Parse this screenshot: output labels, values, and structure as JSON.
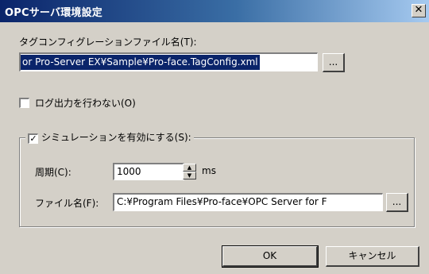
{
  "window": {
    "title": "OPCサーバ環境設定",
    "close_glyph": "✕"
  },
  "tag_config": {
    "label": "タグコンフィグレーションファイル名(T):",
    "path_value": "or Pro-Server EX¥Sample¥Pro-face.TagConfig.xml",
    "browse_label": "..."
  },
  "no_log": {
    "checked": false,
    "label": "ログ出力を行わない(O)"
  },
  "simulation": {
    "checked": true,
    "check_glyph": "✓",
    "label": "シミュレーションを有効にする(S):",
    "period_label": "周期(C):",
    "period_value": "1000",
    "period_unit": "ms",
    "file_label": "ファイル名(F):",
    "file_value": "C:¥Program Files¥Pro-face¥OPC Server for F",
    "browse_label": "..."
  },
  "buttons": {
    "ok": "OK",
    "cancel": "キャンセル"
  }
}
